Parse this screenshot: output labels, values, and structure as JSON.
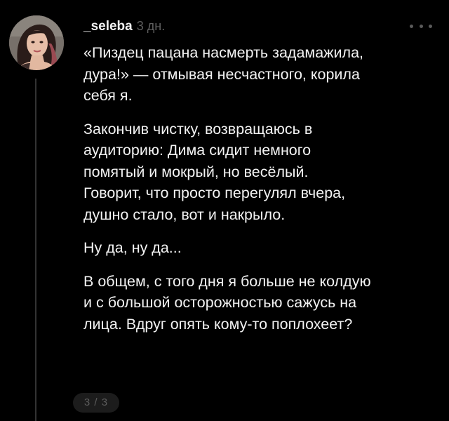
{
  "post": {
    "username": "_seleba",
    "time": "3 дн.",
    "more_icon": "more-dots-icon",
    "avatar": "avatar",
    "paragraphs": [
      "«Пиздец пацана насмерть задамажила,\nдура!» — отмывая несчастного, корила\nсебя я.",
      "Закончив чистку, возвращаюсь в\nаудиторию: Дима сидит немного\nпомятый и мокрый, но весёлый.\nГоворит, что просто перегулял вчера,\nдушно стало, вот и накрыло.",
      "Ну да, ну да...",
      "В общем, с того дня я больше не колдую\nи с большой осторожностью сажусь на\nлица. Вдруг опять кому-то поплохеет?"
    ],
    "page_indicator": "3 / 3"
  },
  "colors": {
    "background": "#000000",
    "text": "#f2f2f2",
    "muted": "#5f5f5f",
    "badge_bg": "#1c1c1c"
  }
}
